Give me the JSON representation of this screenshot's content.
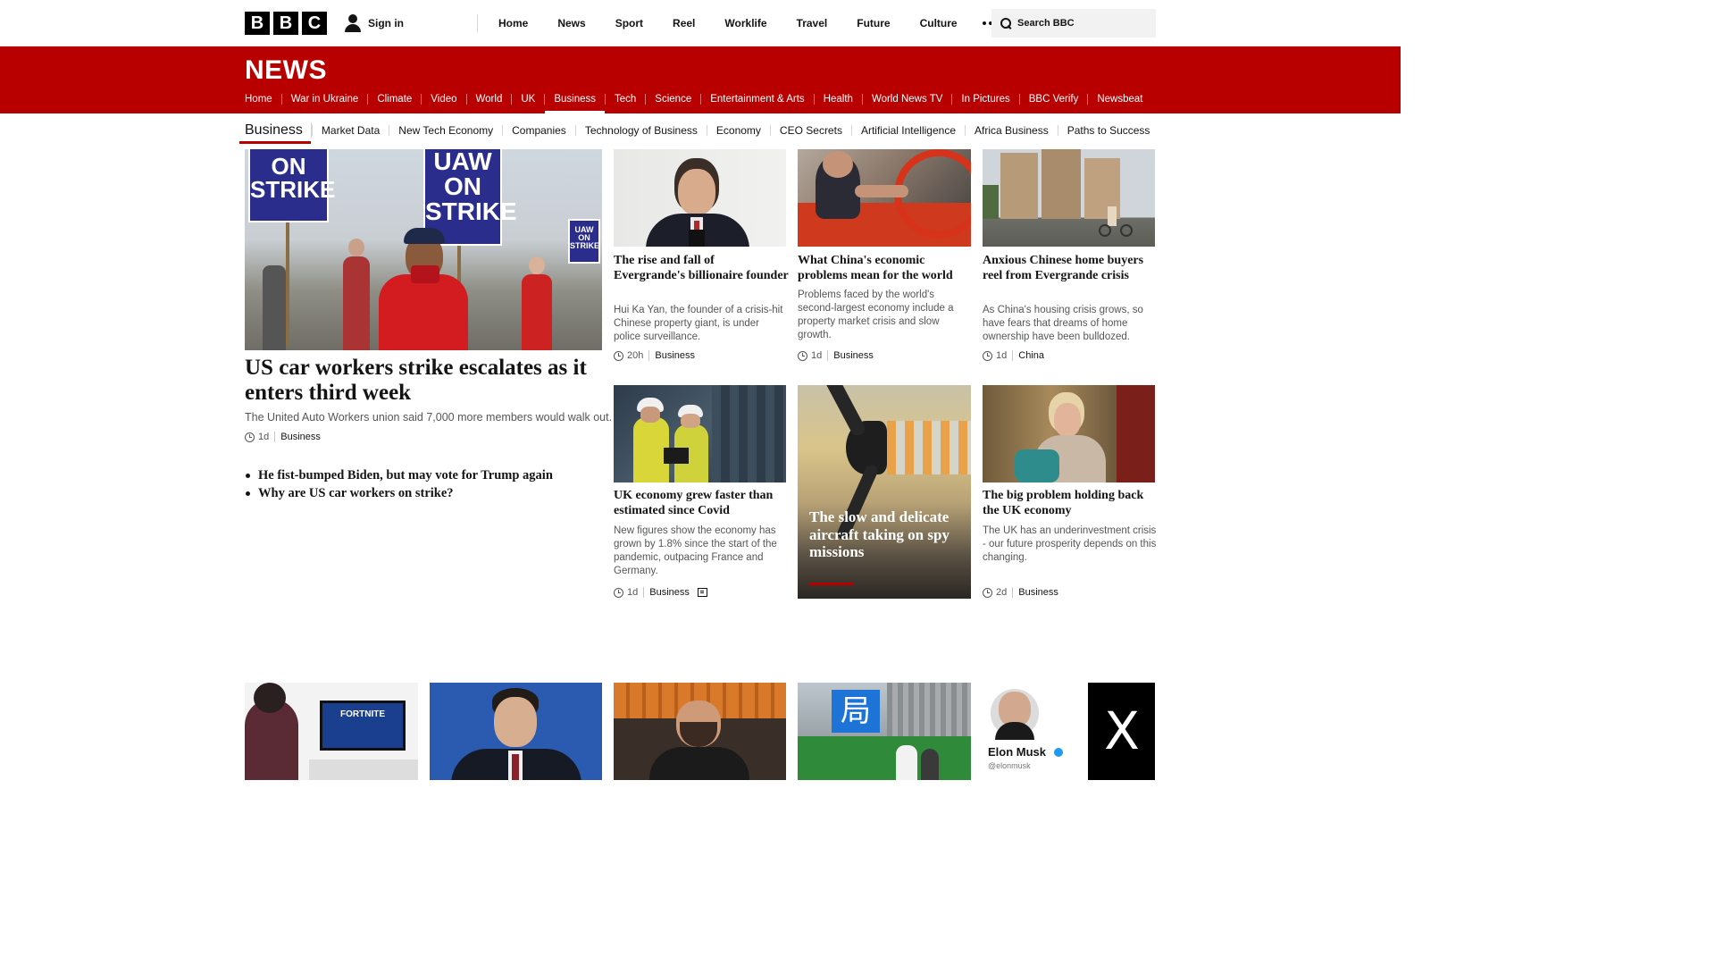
{
  "brand": {
    "letters": [
      "B",
      "B",
      "C"
    ],
    "news_logo": "NEWS",
    "accent_color": "#b80000"
  },
  "top_nav": {
    "signin_label": "Sign in",
    "items": [
      "Home",
      "News",
      "Sport",
      "Reel",
      "Worklife",
      "Travel",
      "Future",
      "Culture"
    ],
    "search_placeholder": "Search BBC"
  },
  "news_nav": {
    "items": [
      "Home",
      "War in Ukraine",
      "Climate",
      "Video",
      "World",
      "UK",
      "Business",
      "Tech",
      "Science",
      "Entertainment & Arts",
      "Health",
      "World News TV",
      "In Pictures",
      "BBC Verify",
      "Newsbeat"
    ],
    "active": "Business"
  },
  "section_nav": {
    "title": "Business",
    "items": [
      "Market Data",
      "New Tech Economy",
      "Companies",
      "Technology of Business",
      "Economy",
      "CEO Secrets",
      "Artificial Intelligence",
      "Africa Business",
      "Paths to Success"
    ]
  },
  "lead": {
    "image_signs": [
      "ON STRIKE",
      "UAW ON STRIKE",
      "UAW ON STRIKE"
    ],
    "title": "US car workers strike escalates as it enters third week",
    "description": "The United Auto Workers union said 7,000 more members would walk out.",
    "time": "1d",
    "tag": "Business",
    "related": [
      "He fist-bumped Biden, but may vote for Trump again",
      "Why are US car workers on strike?"
    ]
  },
  "cards": [
    {
      "title": "The rise and fall of Evergrande's billionaire founder",
      "description": "Hui Ka Yan, the founder of a crisis-hit Chinese property giant, is under police surveillance.",
      "time": "20h",
      "tag": "Business"
    },
    {
      "title": "What China's economic problems mean for the world",
      "description": "Problems faced by the world's second-largest economy include a property market crisis and slow growth.",
      "time": "1d",
      "tag": "Business"
    },
    {
      "title": "Anxious Chinese home buyers reel from Evergrande crisis",
      "description": "As China's housing crisis grows, so have fears that dreams of home ownership have been bulldozed.",
      "time": "1d",
      "tag": "China"
    },
    {
      "title": "UK economy grew faster than estimated since Covid",
      "description": "New figures show the economy has grown by 1.8% since the start of the pandemic, outpacing France and Germany.",
      "time": "1d",
      "tag": "Business"
    },
    {
      "title": "The slow and delicate aircraft taking on spy missions"
    },
    {
      "title": "The big problem holding back the UK economy",
      "description": "The UK has an underinvestment crisis - our future prosperity depends on this changing.",
      "time": "2d",
      "tag": "Business"
    }
  ],
  "bottom_row_image_text": {
    "fortnite": "FORTNITE",
    "bureau_sign": "局",
    "musk_name": "Elon Musk",
    "musk_handle": "@elonmusk",
    "x_logo": "X"
  }
}
